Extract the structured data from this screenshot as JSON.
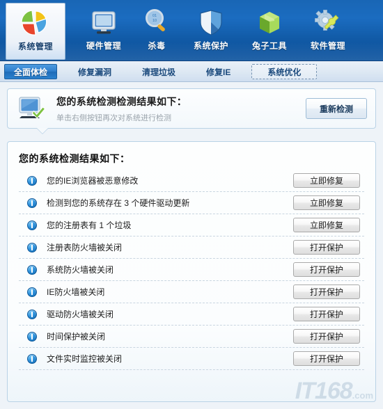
{
  "toolbar": {
    "items": [
      {
        "label": "系统管理",
        "icon": "pie-chart-icon",
        "active": true
      },
      {
        "label": "硬件管理",
        "icon": "monitor-icon",
        "active": false
      },
      {
        "label": "杀毒",
        "icon": "magnifier-icon",
        "active": false
      },
      {
        "label": "系统保护",
        "icon": "shield-icon",
        "active": false
      },
      {
        "label": "兔子工具",
        "icon": "green-box-icon",
        "active": false
      },
      {
        "label": "软件管理",
        "icon": "gear-wrench-icon",
        "active": false
      }
    ]
  },
  "tabs": [
    {
      "label": "全面体检",
      "state": "active"
    },
    {
      "label": "修复漏洞",
      "state": "normal"
    },
    {
      "label": "清理垃圾",
      "state": "normal"
    },
    {
      "label": "修复IE",
      "state": "normal"
    },
    {
      "label": "系统优化",
      "state": "focused"
    }
  ],
  "info_panel": {
    "icon": "monitor-check-icon",
    "title": "您的系统检测检测结果如下：",
    "subtitle": "单击右侧按钮再次对系统进行检测",
    "button_label": "重新检测"
  },
  "results": {
    "heading": "您的系统检测结果如下：",
    "rows": [
      {
        "icon": "info-exclamation-icon",
        "label": "您的IE浏览器被恶意修改",
        "action": "立即修复"
      },
      {
        "icon": "info-exclamation-icon",
        "label": "检测到您的系统存在 3 个硬件驱动更新",
        "action": "立即修复"
      },
      {
        "icon": "info-exclamation-icon",
        "label": "您的注册表有 1 个垃圾",
        "action": "立即修复"
      },
      {
        "icon": "info-exclamation-icon",
        "label": "注册表防火墙被关闭",
        "action": "打开保护"
      },
      {
        "icon": "info-exclamation-icon",
        "label": "系统防火墙被关闭",
        "action": "打开保护"
      },
      {
        "icon": "info-exclamation-icon",
        "label": "IE防火墙被关闭",
        "action": "打开保护"
      },
      {
        "icon": "info-exclamation-icon",
        "label": "驱动防火墙被关闭",
        "action": "打开保护"
      },
      {
        "icon": "info-exclamation-icon",
        "label": "时间保护被关闭",
        "action": "打开保护"
      },
      {
        "icon": "info-exclamation-icon",
        "label": "文件实时监控被关闭",
        "action": "打开保护"
      }
    ]
  },
  "watermark": {
    "text": "IT168",
    "suffix": ".com"
  },
  "colors": {
    "toolbar_blue": "#1b6cc0",
    "tab_active": "#2e7ecb",
    "panel_border": "#b9d2e6",
    "row_icon_blue": "#2e92dd",
    "text_dark": "#1c1c1c",
    "subtitle_gray": "#9aa3ab"
  }
}
